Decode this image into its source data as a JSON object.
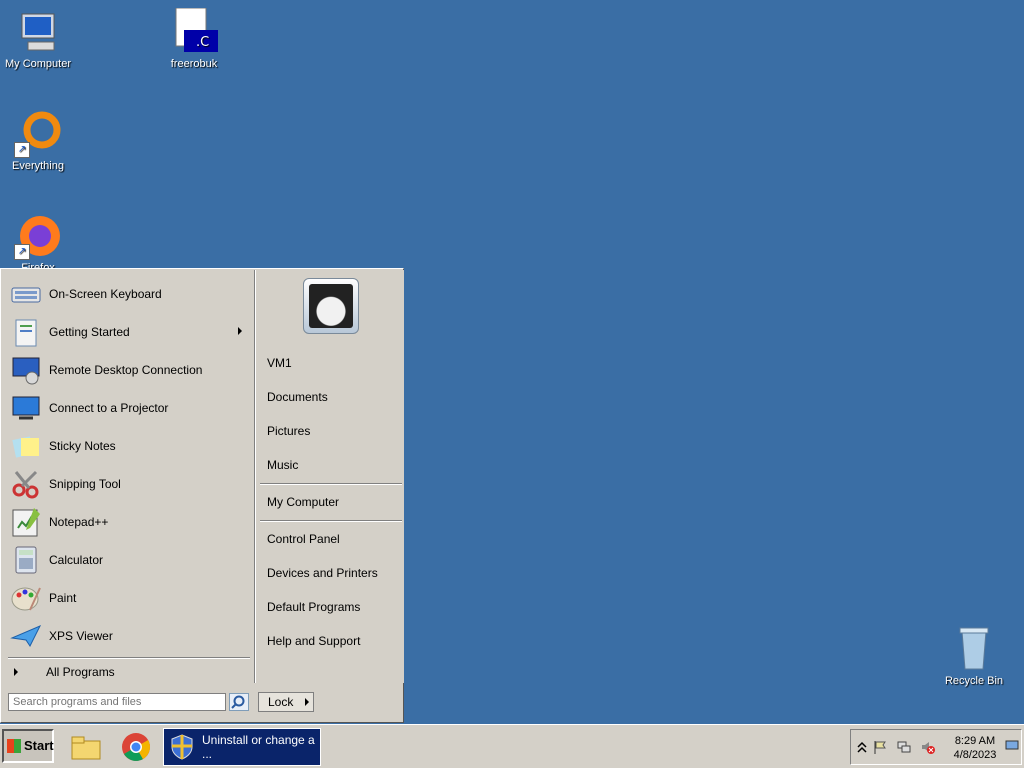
{
  "desktop": {
    "icons": [
      {
        "label": "My Computer"
      },
      {
        "label": "freerobuk"
      },
      {
        "label": "Everything"
      },
      {
        "label": "Firefox"
      },
      {
        "label": "Recycle Bin"
      }
    ],
    "background_color": "#3a6ea5"
  },
  "start_menu": {
    "programs": [
      {
        "label": "On-Screen Keyboard",
        "icon": "keyboard-icon"
      },
      {
        "label": "Getting Started",
        "icon": "getting-started-icon",
        "has_submenu": true
      },
      {
        "label": "Remote Desktop Connection",
        "icon": "remote-desktop-icon"
      },
      {
        "label": "Connect to a Projector",
        "icon": "projector-icon"
      },
      {
        "label": "Sticky Notes",
        "icon": "sticky-notes-icon"
      },
      {
        "label": "Snipping Tool",
        "icon": "snipping-tool-icon"
      },
      {
        "label": "Notepad++",
        "icon": "notepad-plus-plus-icon"
      },
      {
        "label": "Calculator",
        "icon": "calculator-icon"
      },
      {
        "label": "Paint",
        "icon": "paint-icon"
      },
      {
        "label": "XPS Viewer",
        "icon": "xps-viewer-icon"
      }
    ],
    "all_programs": "All Programs",
    "search_placeholder": "Search programs and files",
    "lock_label": "Lock",
    "right_links": {
      "user": "VM1",
      "documents": "Documents",
      "pictures": "Pictures",
      "music": "Music",
      "computer": "My Computer",
      "control_panel": "Control Panel",
      "devices": "Devices and Printers",
      "default_programs": "Default Programs",
      "help": "Help and Support"
    }
  },
  "taskbar": {
    "start_label": "Start",
    "task_button": "Uninstall or change a ...",
    "clock_time": "8:29 AM",
    "clock_date": "4/8/2023"
  }
}
